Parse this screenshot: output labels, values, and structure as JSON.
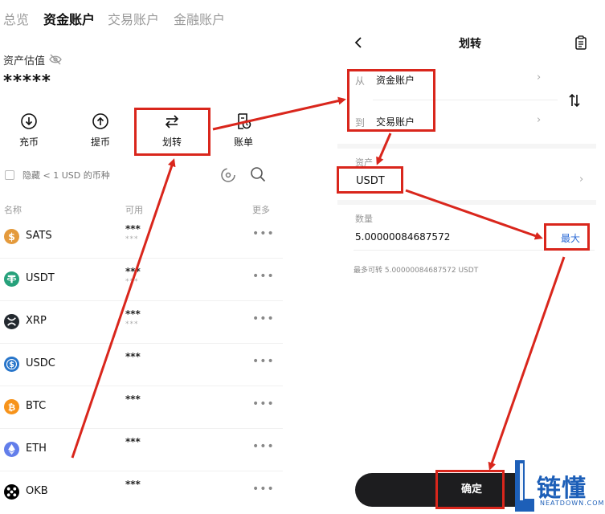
{
  "left": {
    "tabs": [
      {
        "label": "总览"
      },
      {
        "label": "资金账户"
      },
      {
        "label": "交易账户"
      },
      {
        "label": "金融账户"
      }
    ],
    "asset_label": "资产估值",
    "asset_value": "*****",
    "actions": [
      {
        "label": "充币",
        "icon": "deposit-icon"
      },
      {
        "label": "提币",
        "icon": "withdraw-icon"
      },
      {
        "label": "划转",
        "icon": "transfer-icon"
      },
      {
        "label": "账单",
        "icon": "bill-icon"
      }
    ],
    "hide_small_label": "隐藏 < 1 USD 的币种",
    "columns": {
      "name": "名称",
      "available": "可用",
      "more": "更多"
    },
    "coins": [
      {
        "name": "SATS",
        "available": "***",
        "sub": "***",
        "color": "#e49a3c",
        "glyph": "$"
      },
      {
        "name": "USDT",
        "available": "***",
        "sub": "***",
        "color": "#26a17b",
        "glyph": "T"
      },
      {
        "name": "XRP",
        "available": "***",
        "sub": "***",
        "color": "#23292f",
        "glyph": "✕"
      },
      {
        "name": "USDC",
        "available": "***",
        "sub": "",
        "color": "#2775ca",
        "glyph": "$"
      },
      {
        "name": "BTC",
        "available": "***",
        "sub": "",
        "color": "#f7931a",
        "glyph": "₿"
      },
      {
        "name": "ETH",
        "available": "***",
        "sub": "",
        "color": "#627eea",
        "glyph": "◆"
      },
      {
        "name": "OKB",
        "available": "***",
        "sub": "",
        "color": "#000000",
        "glyph": "✣"
      }
    ],
    "more_glyph": "•••"
  },
  "right": {
    "title": "划转",
    "from_label": "从",
    "from_value": "资金账户",
    "to_label": "到",
    "to_value": "交易账户",
    "asset_label": "资产",
    "asset_value": "USDT",
    "amount_label": "数量",
    "amount_value": "5.00000084687572",
    "max_label": "最大",
    "limit_text": "最多可转 5.00000084687572 USDT",
    "confirm_label": "确定"
  },
  "watermark": {
    "name": "链懂",
    "domain": "NEATDOWN.COM"
  },
  "colors": {
    "annotation_red": "#d9261c",
    "brand_blue": "#1d5fb8",
    "link_blue": "#2d6bd6"
  }
}
